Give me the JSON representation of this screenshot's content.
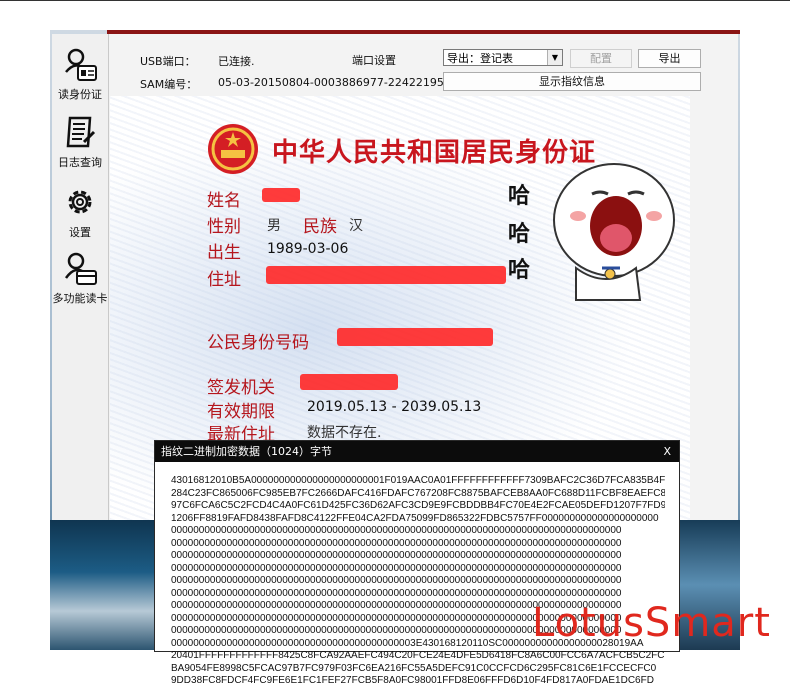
{
  "sidebar": {
    "items": [
      {
        "label": "读身份证",
        "icon": "id-card-reader-icon"
      },
      {
        "label": "日志查询",
        "icon": "log-query-icon"
      },
      {
        "label": "设置",
        "icon": "gear-icon"
      },
      {
        "label": "多功能读卡",
        "icon": "multi-card-reader-icon"
      }
    ]
  },
  "toolbar": {
    "usb_label": "USB端口：",
    "usb_status": "已连接.",
    "port_settings": "端口设置",
    "sam_label": "SAM编号：",
    "sam_value": "05-03-20150804-0003886977-2242219529",
    "export_select": "导出：登记表",
    "config_button": "配置",
    "export_button": "导出",
    "show_fingerprint_button": "显示指纹信息"
  },
  "card": {
    "title": "中华人民共和国居民身份证",
    "name_label": "姓名",
    "gender_label": "性别",
    "gender_value": "男",
    "ethnicity_label": "民族",
    "ethnicity_value": "汉",
    "birth_label": "出生",
    "birth_value": "1989-03-06",
    "address_label": "住址",
    "id_label": "公民身份号码",
    "issuer_label": "签发机关",
    "validity_label": "有效期限",
    "validity_value": "2019.05.13 - 2039.05.13",
    "latest_address_label": "最新住址",
    "latest_address_value": "数据不存在.",
    "haha": [
      "哈",
      "哈",
      "哈"
    ]
  },
  "dialog": {
    "title": "指纹二进制加密数据（1024）字节",
    "close": "X",
    "lines": [
      "43016812010B5A000000000000000000000001F019AAC0A01FFFFFFFFFFFF7309BAFC2C36D7FCA835B4FC",
      "284C23FC865006FC985EB7FC2666DAFC416FDAFC767208FC8875BAFCEB8AA0FC688D11FCBF8EAEFC82",
      "97C6FCA6C5C2FCD4C4A0FC61D425FC36D62AFC3CD9E9FCBDDBB4FC70E4E2FCAE05DEFD1207F7FD95",
      "1206FF8819FAFD8438FAFD8C4122FFE04CA2FDA75099FD865322FDBC5757FF000000000000000000000",
      "000000000000000000000000000000000000000000000000000000000000000000000000000000000",
      "000000000000000000000000000000000000000000000000000000000000000000000000000000000",
      "000000000000000000000000000000000000000000000000000000000000000000000000000000000",
      "000000000000000000000000000000000000000000000000000000000000000000000000000000000",
      "000000000000000000000000000000000000000000000000000000000000000000000000000000000",
      "000000000000000000000000000000000000000000000000000000000000000000000000000000000",
      "000000000000000000000000000000000000000000000000000000000000000000000000000000000",
      "000000000000000000000000000000000000000000000000000000000000000000000000000000000",
      "000000000000000000000000000000000000000000000000000000000000000000000000000000000",
      "00000000000000000000000000000000000000000003E430168120110SC00000000000000000028019AA",
      "20401FFFFFFFFFFFFF8425C8FCA92AAEFC494C20FCE24E4DFE5D6418FC8A6C00FCC6A7ACFCB5C2FC",
      "BA9054FE8998C5FCAC97B7FC979F03FC6EA216FC55A5DEFC91C0CCFCD6C295FC81C6E1FCCECFC0",
      "9DD38FC8FDCF4FC9FE6E1FC1FEF27FCB5F8A0FC98001FFD8E06FFFD6D10F4FD817A0FDAE1DC6FD"
    ]
  },
  "watermark": "LotusSmart"
}
